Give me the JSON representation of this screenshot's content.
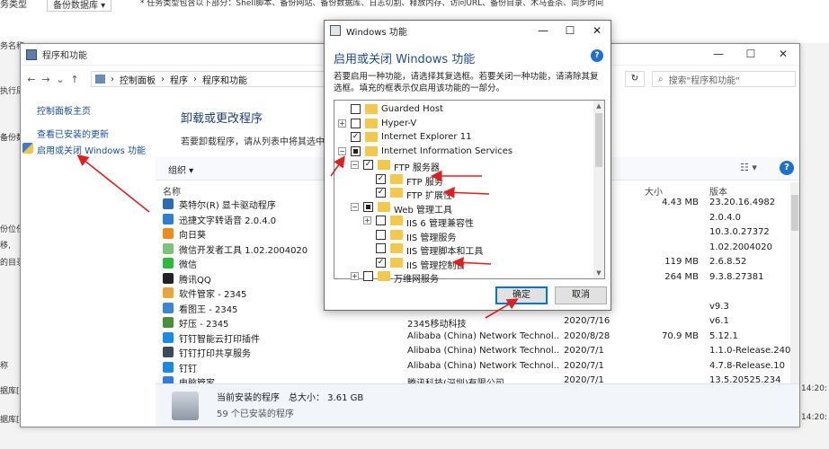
{
  "background": {
    "top_label": "务类型",
    "top_select": "备份数据库 ▾",
    "top_notice": "* 任务类型包含以下部分：Shell脚本、备份网站、备份数据库、日志切割、释放内存、访问URL、备份目录、木马查杀、同步时间",
    "left_labels": [
      "务名称",
      "执行周",
      "备份数据",
      "份位任",
      "移,",
      "的目录",
      "称",
      "据库[",
      "据库["
    ],
    "right_labels": [
      "14:20:",
      "14:20:"
    ]
  },
  "window": {
    "title": "程序和功能",
    "controls": [
      "—",
      "☐",
      "✕"
    ],
    "breadcrumb": [
      "控制面板",
      "程序",
      "程序和功能"
    ],
    "refresh": "↻",
    "search_placeholder": "搜索\"程序和功能\"",
    "side_links": [
      "控制面板主页",
      "查看已安装的更新",
      "启用或关闭 Windows 功能"
    ],
    "main_title": "卸载或更改程序",
    "main_subtitle": "若要卸载程序，请从列表中将其选中，",
    "organize": "组织 ▾",
    "view_icon": "☷ ▾",
    "help": "?",
    "columns": [
      "名称",
      "大小",
      "版本"
    ],
    "programs": [
      {
        "name": "英特尔(R) 显卡驱动程序",
        "publisher": "",
        "date": "",
        "size": "4.43 MB",
        "version": "23.20.16.4982",
        "color": "#2a6db5"
      },
      {
        "name": "迅捷文字转语音 2.0.4.0",
        "publisher": "",
        "date": "",
        "size": "",
        "version": "2.0.4.0",
        "color": "#2d7fd3"
      },
      {
        "name": "向日葵",
        "publisher": "",
        "date": "",
        "size": "",
        "version": "10.3.0.27372",
        "color": "#f08a1c"
      },
      {
        "name": "微信开发者工具 1.02.2004020",
        "publisher": "",
        "date": "",
        "size": "",
        "version": "1.02.2004020",
        "color": "#7cc47a"
      },
      {
        "name": "微信",
        "publisher": "",
        "date": "",
        "size": "119 MB",
        "version": "2.6.8.52",
        "color": "#2dbb3a"
      },
      {
        "name": "腾讯QQ",
        "publisher": "",
        "date": "",
        "size": "264 MB",
        "version": "9.3.8.27381",
        "color": "#222222"
      },
      {
        "name": "软件管家 - 2345",
        "publisher": "",
        "date": "",
        "size": "",
        "version": "",
        "color": "#e8a53a"
      },
      {
        "name": "看图王 - 2345",
        "publisher": "",
        "date": "",
        "size": "",
        "version": "v9.3",
        "color": "#3a86d6"
      },
      {
        "name": "好压 - 2345",
        "publisher": "2345移动科技",
        "date": "2020/7/16",
        "size": "",
        "version": "v6.1",
        "color": "#4a8f3a"
      },
      {
        "name": "钉钉智能云打印插件",
        "publisher": "Alibaba (China) Network Technol...",
        "date": "2020/8/28",
        "size": "70.9 MB",
        "version": "5.12.1",
        "color": "#1b8ae6"
      },
      {
        "name": "钉钉打印共享服务",
        "publisher": "Alibaba (China) Network Technol...",
        "date": "2020/7/1",
        "size": "",
        "version": "1.1.0-Release.240",
        "color": "#3d4a5c"
      },
      {
        "name": "钉钉",
        "publisher": "Alibaba (China) Network Technol...",
        "date": "2020/7/1",
        "size": "",
        "version": "4.7.8-Release.10",
        "color": "#1b8ae6"
      },
      {
        "name": "电脑管家",
        "publisher": "腾讯科技(深圳)有限公司",
        "date": "2020/7/1",
        "size": "",
        "version": "13.5.20525.234",
        "color": "#2f7fe0"
      }
    ],
    "status_line1": "当前安装的程序　总大小：  3.61 GB",
    "status_line2": "59 个已安装的程序"
  },
  "dialog": {
    "title": "Windows 功能",
    "controls": [
      "—",
      "☐",
      "✕"
    ],
    "heading": "启用或关闭 Windows 功能",
    "help": "?",
    "description": "若要启用一种功能，请选择其复选框。若要关闭一种功能，请清除其复选框。填充的框表示仅启用该功能的一部分。",
    "features": [
      {
        "level": 0,
        "expander": "",
        "state": "off",
        "label": "Guarded Host"
      },
      {
        "level": 0,
        "expander": "+",
        "state": "off",
        "label": "Hyper-V"
      },
      {
        "level": 0,
        "expander": "",
        "state": "on",
        "label": "Internet Explorer 11"
      },
      {
        "level": 0,
        "expander": "−",
        "state": "partial",
        "label": "Internet Information Services"
      },
      {
        "level": 1,
        "expander": "−",
        "state": "on",
        "label": "FTP 服务器"
      },
      {
        "level": 2,
        "expander": "",
        "state": "on",
        "label": "FTP 服务"
      },
      {
        "level": 2,
        "expander": "",
        "state": "on",
        "label": "FTP 扩展性"
      },
      {
        "level": 1,
        "expander": "−",
        "state": "partial",
        "label": "Web 管理工具"
      },
      {
        "level": 2,
        "expander": "+",
        "state": "off",
        "label": "IIS 6 管理兼容性"
      },
      {
        "level": 2,
        "expander": "",
        "state": "off",
        "label": "IIS 管理服务"
      },
      {
        "level": 2,
        "expander": "",
        "state": "off",
        "label": "IIS 管理脚本和工具"
      },
      {
        "level": 2,
        "expander": "",
        "state": "on",
        "label": "IIS 管理控制台"
      },
      {
        "level": 1,
        "expander": "+",
        "state": "off",
        "label": "万维网服务"
      }
    ],
    "ok": "确定",
    "cancel": "取消"
  },
  "colors": {
    "accent": "#0078d7",
    "link": "#1a4e9a",
    "arrow": "#e02020",
    "folder": "#f2c94c"
  }
}
